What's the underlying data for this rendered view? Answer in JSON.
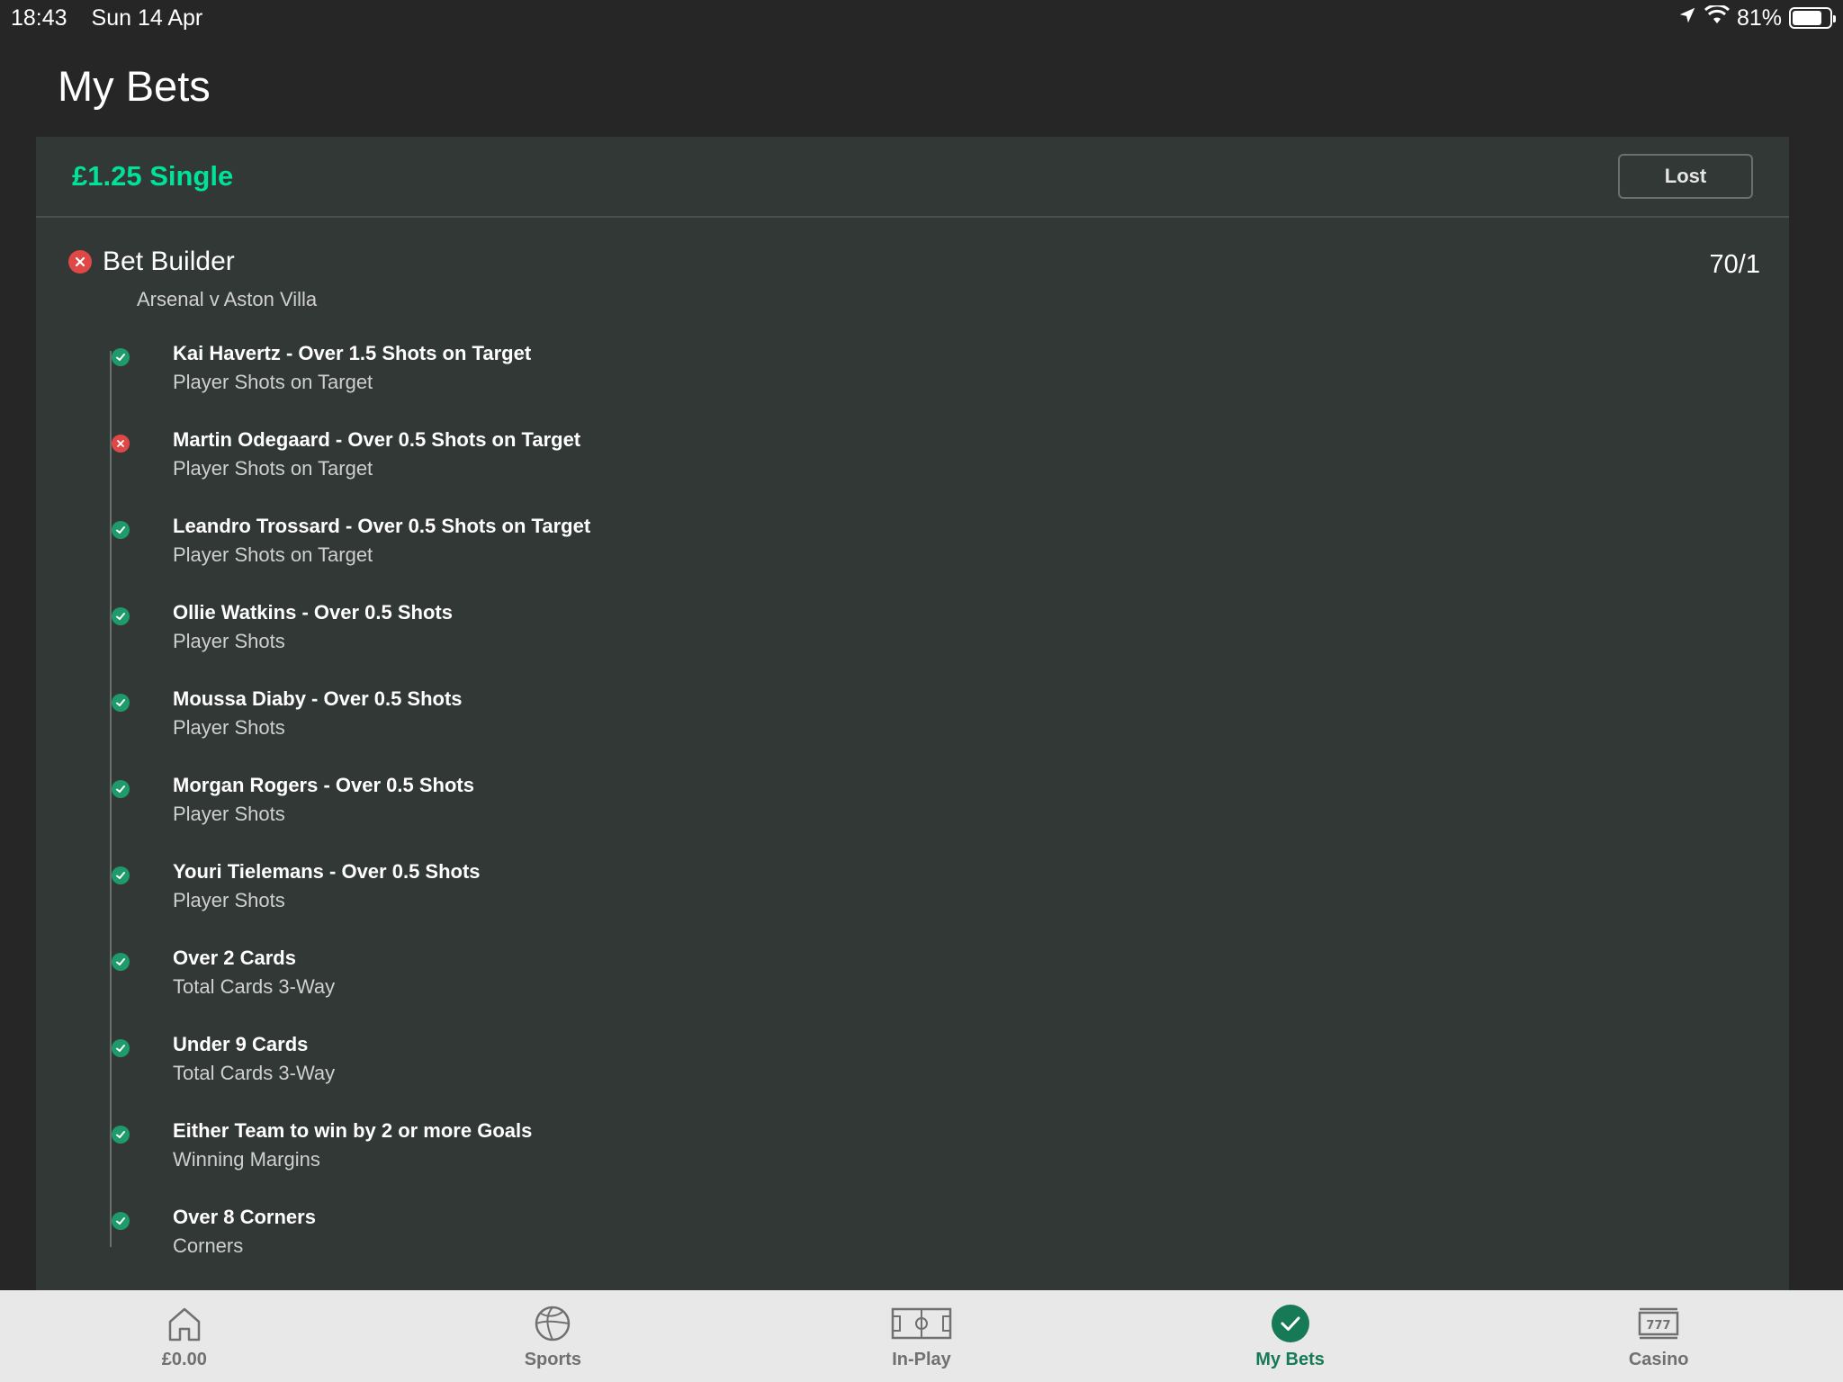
{
  "status_bar": {
    "time": "18:43",
    "date": "Sun 14 Apr",
    "battery_percent": "81%",
    "battery_level": 0.81
  },
  "page": {
    "title": "My Bets"
  },
  "bet": {
    "stake_label": "£1.25 Single",
    "status": "Lost",
    "type_title": "Bet Builder",
    "type_status": "lost",
    "match": "Arsenal v Aston Villa",
    "odds": "70/1",
    "legs": [
      {
        "name": "Kai Havertz - Over 1.5 Shots on Target",
        "market": "Player Shots on Target",
        "result": "won"
      },
      {
        "name": "Martin Odegaard - Over 0.5 Shots on Target",
        "market": "Player Shots on Target",
        "result": "lost"
      },
      {
        "name": "Leandro Trossard - Over 0.5 Shots on Target",
        "market": "Player Shots on Target",
        "result": "won"
      },
      {
        "name": "Ollie Watkins - Over 0.5 Shots",
        "market": "Player Shots",
        "result": "won"
      },
      {
        "name": "Moussa Diaby - Over 0.5 Shots",
        "market": "Player Shots",
        "result": "won"
      },
      {
        "name": "Morgan Rogers - Over 0.5 Shots",
        "market": "Player Shots",
        "result": "won"
      },
      {
        "name": "Youri Tielemans - Over 0.5 Shots",
        "market": "Player Shots",
        "result": "won"
      },
      {
        "name": "Over 2 Cards",
        "market": "Total Cards 3-Way",
        "result": "won"
      },
      {
        "name": "Under 9 Cards",
        "market": "Total Cards 3-Way",
        "result": "won"
      },
      {
        "name": "Either Team to win by 2 or more Goals",
        "market": "Winning Margins",
        "result": "won"
      },
      {
        "name": "Over 8 Corners",
        "market": "Corners",
        "result": "won"
      }
    ]
  },
  "tabs": [
    {
      "label": "£0.00",
      "icon": "home-icon",
      "active": false
    },
    {
      "label": "Sports",
      "icon": "football-icon",
      "active": false
    },
    {
      "label": "In-Play",
      "icon": "pitch-icon",
      "active": false
    },
    {
      "label": "My Bets",
      "icon": "check-circle-icon",
      "active": true
    },
    {
      "label": "Casino",
      "icon": "slot-machine-icon",
      "active": false
    }
  ],
  "colors": {
    "accent_green": "#00e29a",
    "won_green": "#1e9a6b",
    "lost_red": "#e04848",
    "active_tab": "#157a55"
  }
}
